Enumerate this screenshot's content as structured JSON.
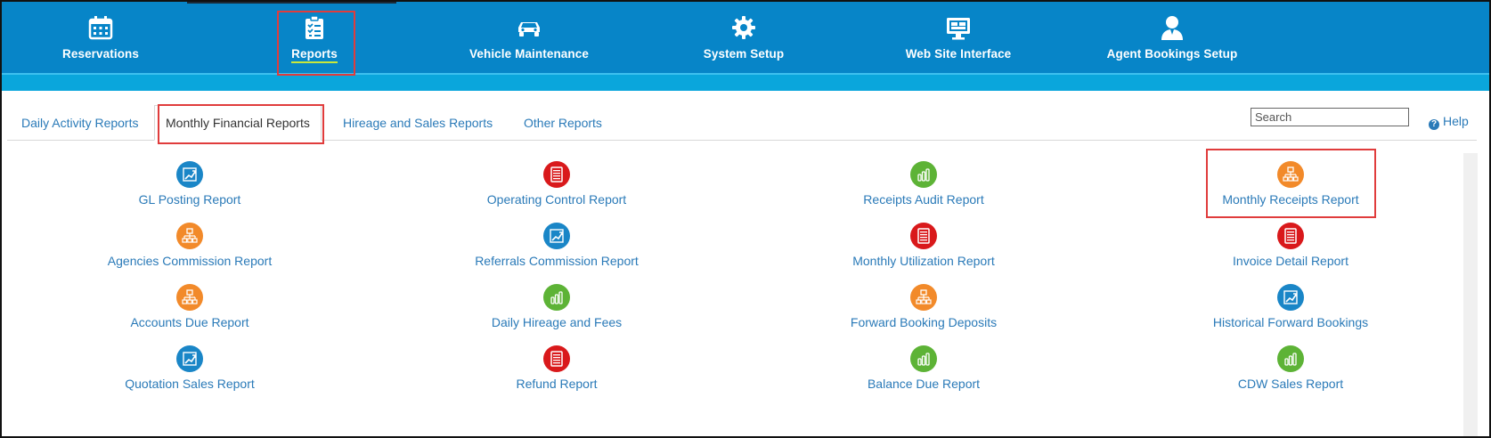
{
  "nav": {
    "items": [
      {
        "label": "Reservations",
        "icon": "calendar-icon"
      },
      {
        "label": "Reports",
        "icon": "checklist-icon"
      },
      {
        "label": "Vehicle Maintenance",
        "icon": "car-icon"
      },
      {
        "label": "System Setup",
        "icon": "gear-icon"
      },
      {
        "label": "Web Site Interface",
        "icon": "monitor-icon"
      },
      {
        "label": "Agent Bookings Setup",
        "icon": "agent-icon"
      }
    ]
  },
  "tabs": [
    {
      "label": "Daily Activity Reports"
    },
    {
      "label": "Monthly Financial Reports"
    },
    {
      "label": "Hireage and Sales Reports"
    },
    {
      "label": "Other Reports"
    }
  ],
  "search": {
    "placeholder": "Search"
  },
  "help": {
    "label": "Help"
  },
  "colors": {
    "blue": "#1a86c7",
    "red": "#d9191b",
    "green": "#5db336",
    "orange": "#f28a2a"
  },
  "reports": [
    [
      {
        "label": "GL Posting Report",
        "icon": "chart-icon"
      },
      {
        "label": "Agencies Commission Report",
        "icon": "org-chart-icon"
      },
      {
        "label": "Accounts Due Report",
        "icon": "org-chart-icon"
      },
      {
        "label": "Quotation Sales Report",
        "icon": "chart-icon"
      }
    ],
    [
      {
        "label": "Operating Control Report",
        "icon": "document-icon"
      },
      {
        "label": "Referrals Commission Report",
        "icon": "chart-icon"
      },
      {
        "label": "Daily Hireage and Fees",
        "icon": "bar-chart-icon"
      },
      {
        "label": "Refund Report",
        "icon": "document-icon"
      }
    ],
    [
      {
        "label": "Receipts Audit Report",
        "icon": "bar-chart-icon"
      },
      {
        "label": "Monthly Utilization Report",
        "icon": "document-icon"
      },
      {
        "label": "Forward Booking Deposits",
        "icon": "org-chart-icon"
      },
      {
        "label": "Balance Due Report",
        "icon": "bar-chart-icon"
      }
    ],
    [
      {
        "label": "Monthly Receipts Report",
        "icon": "org-chart-icon"
      },
      {
        "label": "Invoice Detail Report",
        "icon": "document-icon"
      },
      {
        "label": "Historical Forward Bookings",
        "icon": "chart-icon"
      },
      {
        "label": "CDW Sales Report",
        "icon": "bar-chart-icon"
      }
    ]
  ]
}
